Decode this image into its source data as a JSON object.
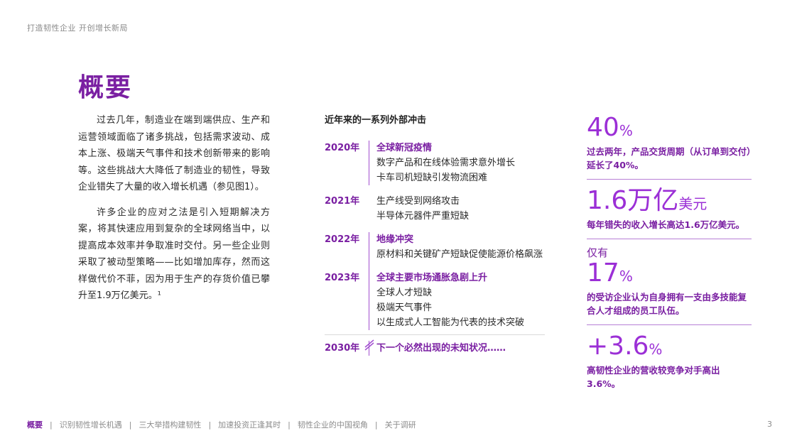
{
  "header": {
    "title": "打造韧性企业  开创增长新局"
  },
  "page_title": "概要",
  "intro": {
    "paragraphs": [
      "过去几年，制造业在端到端供应、生产和运营领域面临了诸多挑战，包括需求波动、成本上涨、极端天气事件和技术创新带来的影响等。这些挑战大大降低了制造业的韧性，导致企业错失了大量的收入增长机遇（参见图1）。",
      "许多企业的应对之法是引入短期解决方案，将其快速应用到复杂的全球网络当中，以提高成本效率并争取准时交付。另一些企业则采取了被动型策略——比如增加库存，然而这样做代价不菲，因为用于生产的存货价值已攀升至1.9万亿美元。¹"
    ]
  },
  "shocks": {
    "title": "近年来的一系列外部冲击",
    "entries": [
      {
        "year": "2020年",
        "headline": "全球新冠疫情",
        "items": [
          "数字产品和在线体验需求意外增长",
          "卡车司机短缺引发物流困难"
        ]
      },
      {
        "year": "2021年",
        "headline": "",
        "items": [
          "生产线受到网络攻击",
          "半导体元器件严重短缺"
        ]
      },
      {
        "year": "2022年",
        "headline": "地缘冲突",
        "items": [
          "原材料和关键矿产短缺促使能源价格飙涨"
        ]
      },
      {
        "year": "2023年",
        "headline": "全球主要市场通胀急剧上升",
        "items": [
          "全球人才短缺",
          "极端天气事件",
          "以生成式人工智能为代表的技术突破"
        ]
      }
    ],
    "future": {
      "year": "2030年",
      "headline": "下一个必然出现的未知状况……"
    }
  },
  "stats": [
    {
      "pre": "",
      "number": "40",
      "unit": "%",
      "desc": "过去两年，产品交货周期（从订单到交付）延长了40%。"
    },
    {
      "pre": "",
      "number": "1.6万亿",
      "unit": "美元",
      "desc": "每年错失的收入增长高达1.6万亿美元。"
    },
    {
      "pre": "仅有",
      "number": "17",
      "unit": "%",
      "desc": "的受访企业认为自身拥有一支由多技能复合人才组成的员工队伍。"
    },
    {
      "pre": "",
      "number": "+3.6",
      "unit": "%",
      "desc": "高韧性企业的营收较竞争对手高出3.6%。"
    }
  ],
  "footer": {
    "nav": [
      "概要",
      "识别韧性增长机遇",
      "三大举措构建韧性",
      "加速投资正逢其时",
      "韧性企业的中国视角",
      "关于调研"
    ],
    "active_index": 0,
    "page_number": "3"
  },
  "colors": {
    "accent": "#7a1fa2",
    "accent_light": "#9b2fd6",
    "muted": "#8c8c8c"
  }
}
